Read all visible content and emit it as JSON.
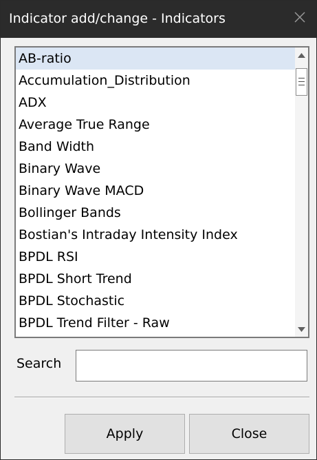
{
  "window": {
    "title": "Indicator add/change - Indicators",
    "close_icon": "close-x-icon"
  },
  "indicator_list": {
    "selected_index": 0,
    "items": [
      "AB-ratio",
      "Accumulation_Distribution",
      "ADX",
      "Average True Range",
      "Band Width",
      "Binary Wave",
      "Binary Wave MACD",
      "Bollinger Bands",
      "Bostian's Intraday Intensity Index",
      "BPDL RSI",
      "BPDL Short Trend",
      "BPDL Stochastic",
      "BPDL Trend Filter - Raw"
    ],
    "scroll_up_icon": "scroll-up-arrow-icon",
    "scroll_down_icon": "scroll-down-arrow-icon"
  },
  "search": {
    "label": "Search",
    "value": ""
  },
  "buttons": {
    "apply": "Apply",
    "close": "Close"
  },
  "colors": {
    "titlebar": "#2b2b2b",
    "selected_row": "#dbe6f4",
    "dialog_bg": "#f0f0f0"
  }
}
